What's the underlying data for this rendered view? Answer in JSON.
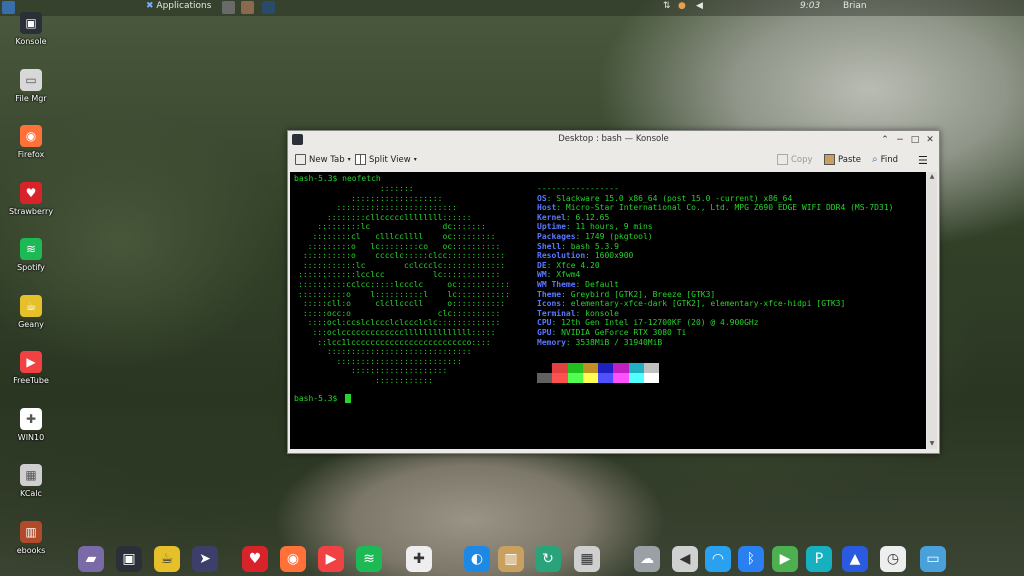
{
  "top_panel": {
    "applications_label": "Applications",
    "clock": "9:03",
    "user": "Brian"
  },
  "desktop_icons": [
    {
      "label": "Konsole",
      "icon": "terminal-icon",
      "color": "#2b2f38"
    },
    {
      "label": "File Mgr",
      "icon": "drive-icon",
      "color": "#d8d8d8"
    },
    {
      "label": "Firefox",
      "icon": "firefox-icon",
      "color": "#ff7139"
    },
    {
      "label": "Strawberry",
      "icon": "strawberry-icon",
      "color": "#d8232a"
    },
    {
      "label": "Spotify",
      "icon": "spotify-icon",
      "color": "#1db954"
    },
    {
      "label": "Geany",
      "icon": "teapot-icon",
      "color": "#e6c02a"
    },
    {
      "label": "FreeTube",
      "icon": "freetube-icon",
      "color": "#f04242"
    },
    {
      "label": "WIN10",
      "icon": "win10-icon",
      "color": "#ffffff"
    },
    {
      "label": "KCalc",
      "icon": "calculator-icon",
      "color": "#cfcfcf"
    },
    {
      "label": "ebooks",
      "icon": "books-icon",
      "color": "#b04a2a"
    }
  ],
  "window": {
    "title": "Desktop : bash — Konsole",
    "toolbar": {
      "new_tab": "New Tab",
      "split_view": "Split View",
      "copy": "Copy",
      "paste": "Paste",
      "find": "Find"
    }
  },
  "terminal": {
    "prompt_command": "bash-5.3$ neofetch",
    "prompt_end": "bash-5.3$ ",
    "separator": "-----------------",
    "info": [
      {
        "key": "OS",
        "value": "Slackware 15.0 x86_64 (post 15.0 -current) x86_64"
      },
      {
        "key": "Host",
        "value": "Micro-Star International Co., Ltd. MPG Z690 EDGE WIFI DDR4 (MS-7D31)"
      },
      {
        "key": "Kernel",
        "value": "6.12.65"
      },
      {
        "key": "Uptime",
        "value": "11 hours, 9 mins"
      },
      {
        "key": "Packages",
        "value": "1749 (pkgtool)"
      },
      {
        "key": "Shell",
        "value": "bash 5.3.9"
      },
      {
        "key": "Resolution",
        "value": "1600x900"
      },
      {
        "key": "DE",
        "value": "Xfce 4.20"
      },
      {
        "key": "WM",
        "value": "Xfwm4"
      },
      {
        "key": "WM Theme",
        "value": "Default"
      },
      {
        "key": "Theme",
        "value": "Greybird [GTK2], Breeze [GTK3]"
      },
      {
        "key": "Icons",
        "value": "elementary-xfce-dark [GTK2], elementary-xfce-hidpi [GTK3]"
      },
      {
        "key": "Terminal",
        "value": "konsole"
      },
      {
        "key": "CPU",
        "value": "12th Gen Intel i7-12700KF (20) @ 4.900GHz"
      },
      {
        "key": "GPU",
        "value": "NVIDIA GeForce RTX 3080 Ti"
      },
      {
        "key": "Memory",
        "value": "3538MiB / 31940MiB"
      }
    ],
    "palette_top": [
      "#000000",
      "#e04040",
      "#20c020",
      "#c09020",
      "#2020c0",
      "#c020c0",
      "#20b0c0",
      "#c0c0c0"
    ],
    "palette_bottom": [
      "#606060",
      "#ff5050",
      "#50ff50",
      "#ffff50",
      "#5050ff",
      "#ff50ff",
      "#50ffff",
      "#ffffff"
    ]
  },
  "dock": [
    {
      "icon": "folder-icon",
      "color": "#7b6aa8"
    },
    {
      "icon": "terminal-icon",
      "color": "#2b2f38"
    },
    {
      "icon": "teapot-icon",
      "color": "#e6c02a"
    },
    {
      "icon": "pointer-icon",
      "color": "#3b3f6a"
    },
    {
      "icon": "strawberry-icon",
      "color": "#d8232a"
    },
    {
      "icon": "firefox-icon",
      "color": "#ff7139"
    },
    {
      "icon": "freetube-icon",
      "color": "#f04242"
    },
    {
      "icon": "spotify-icon",
      "color": "#1db954"
    },
    {
      "icon": "win10-icon",
      "color": "#eeeeee"
    },
    {
      "icon": "browser-icon",
      "color": "#1e88e5"
    },
    {
      "icon": "ebook-reader-icon",
      "color": "#c8a060"
    },
    {
      "icon": "update-icon",
      "color": "#2aa37a"
    },
    {
      "icon": "calculator-icon",
      "color": "#cfcfcf"
    },
    {
      "icon": "weather-icon",
      "color": "#9aa0a6"
    },
    {
      "icon": "volume-icon",
      "color": "#d0d0d0"
    },
    {
      "icon": "wifi-icon",
      "color": "#2aa0f0"
    },
    {
      "icon": "bluetooth-icon",
      "color": "#2a80f0"
    },
    {
      "icon": "install-icon",
      "color": "#4caf50"
    },
    {
      "icon": "pcloud-icon",
      "color": "#17b0c0"
    },
    {
      "icon": "vpn-icon",
      "color": "#2a5adf"
    },
    {
      "icon": "clock-icon",
      "color": "#eeeeee"
    },
    {
      "icon": "display-icon",
      "color": "#4aa0d8"
    }
  ]
}
